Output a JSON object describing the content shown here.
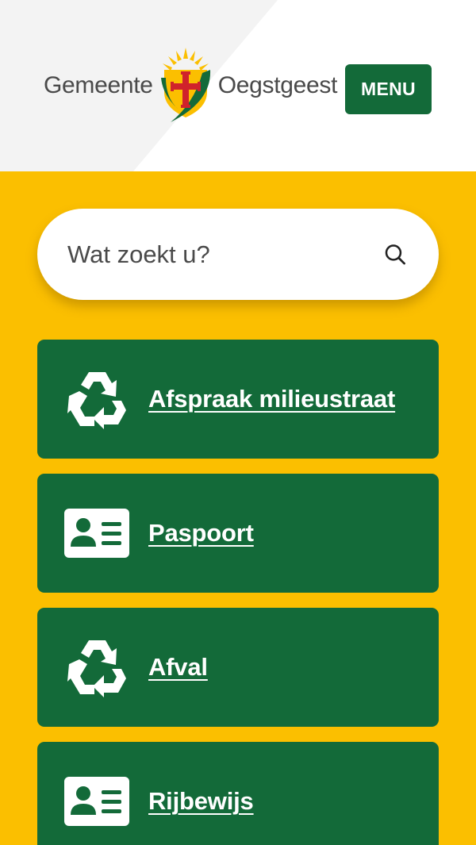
{
  "header": {
    "logo": {
      "word_left": "Gemeente",
      "word_right": "Oegstgeest",
      "emblem_icon": "coat-of-arms-icon"
    },
    "menu_label": "MENU"
  },
  "search": {
    "placeholder": "Wat zoekt u?",
    "value": "",
    "icon": "search-icon"
  },
  "tiles": [
    {
      "label": "Afspraak milieustraat",
      "icon": "recycle-icon"
    },
    {
      "label": "Paspoort",
      "icon": "id-card-icon"
    },
    {
      "label": "Afval",
      "icon": "recycle-icon"
    },
    {
      "label": "Rijbewijs",
      "icon": "id-card-icon"
    }
  ],
  "colors": {
    "background": "#fbbf00",
    "brand_green": "#136a39",
    "header_bg": "#ffffff",
    "header_shade": "#f3f3f3",
    "text_grey": "#4a4a4a"
  }
}
